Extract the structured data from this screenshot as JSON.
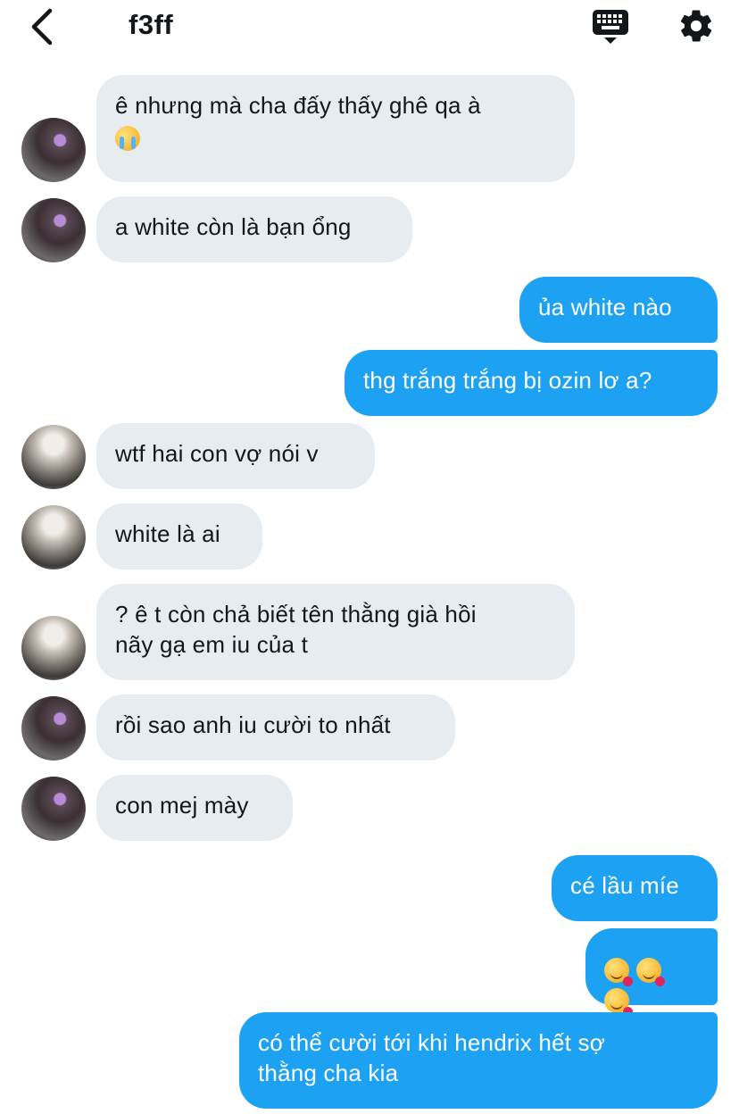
{
  "header": {
    "title": "f3ff",
    "back_icon": "chevron-left-icon",
    "keyboard_icon": "keyboard-icon",
    "settings_icon": "gear-icon"
  },
  "colors": {
    "incoming_bubble": "#e6ecf0",
    "outgoing_bubble": "#1da1f2"
  },
  "messages": [
    {
      "dir": "in",
      "text": "ê nhưng mà cha đấy thấy ghê qa à",
      "emoji": "loudly-crying-face"
    },
    {
      "dir": "in",
      "text": "a white còn là bạn ổng"
    },
    {
      "dir": "out",
      "text": "ủa white nào"
    },
    {
      "dir": "out",
      "text": "thg trắng trắng bị ozin lơ a?"
    },
    {
      "dir": "in",
      "text": "wtf hai con vợ nói v"
    },
    {
      "dir": "in",
      "text": "white là ai"
    },
    {
      "dir": "in",
      "line1": "? ê t còn chả biết tên thằng già hồi",
      "line2": "nãy gạ em iu của t"
    },
    {
      "dir": "in",
      "text": "rồi sao anh iu cười to nhất"
    },
    {
      "dir": "in",
      "text": "con mej mày"
    },
    {
      "dir": "out",
      "text": "cé lầu míe"
    },
    {
      "dir": "out",
      "emoji": "smiling-face-with-hearts x3"
    },
    {
      "dir": "out",
      "line1": "có thể cười tới khi hendrix hết sợ",
      "line2": "thằng cha kia"
    }
  ]
}
